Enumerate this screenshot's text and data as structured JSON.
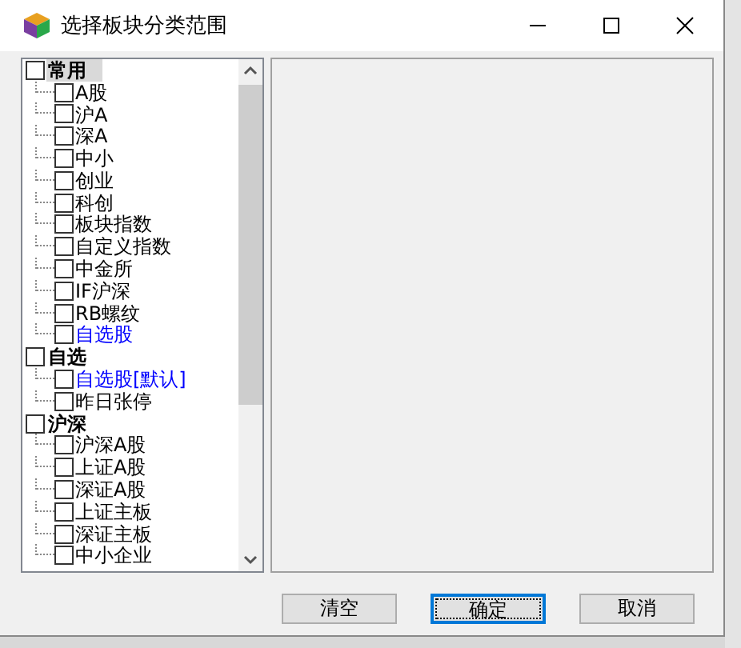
{
  "window": {
    "title": "选择板块分类范围"
  },
  "tree": [
    {
      "label": "常用",
      "checked": false,
      "selected": true,
      "children": [
        {
          "label": "A股",
          "checked": false,
          "color": "#000000"
        },
        {
          "label": "沪A",
          "checked": false,
          "color": "#000000"
        },
        {
          "label": "深A",
          "checked": false,
          "color": "#000000"
        },
        {
          "label": "中小",
          "checked": false,
          "color": "#000000"
        },
        {
          "label": "创业",
          "checked": false,
          "color": "#000000"
        },
        {
          "label": "科创",
          "checked": false,
          "color": "#000000"
        },
        {
          "label": "板块指数",
          "checked": false,
          "color": "#000000"
        },
        {
          "label": "自定义指数",
          "checked": false,
          "color": "#000000"
        },
        {
          "label": "中金所",
          "checked": false,
          "color": "#000000"
        },
        {
          "label": "IF沪深",
          "checked": false,
          "color": "#000000"
        },
        {
          "label": "RB螺纹",
          "checked": false,
          "color": "#000000"
        },
        {
          "label": "自选股",
          "checked": false,
          "color": "#0000ff"
        }
      ]
    },
    {
      "label": "自选",
      "checked": false,
      "selected": false,
      "children": [
        {
          "label": "自选股[默认]",
          "checked": false,
          "color": "#0000ff"
        },
        {
          "label": "昨日张停",
          "checked": false,
          "color": "#000000"
        }
      ]
    },
    {
      "label": "沪深",
      "checked": false,
      "selected": false,
      "children": [
        {
          "label": "沪深A股",
          "checked": false,
          "color": "#000000"
        },
        {
          "label": "上证A股",
          "checked": false,
          "color": "#000000"
        },
        {
          "label": "深证A股",
          "checked": false,
          "color": "#000000"
        },
        {
          "label": "上证主板",
          "checked": false,
          "color": "#000000"
        },
        {
          "label": "深证主板",
          "checked": false,
          "color": "#000000"
        },
        {
          "label": "中小企业",
          "checked": false,
          "color": "#000000"
        }
      ]
    }
  ],
  "buttons": [
    {
      "label": "清空",
      "focused": false
    },
    {
      "label": "确定",
      "focused": true
    },
    {
      "label": "取消",
      "focused": false
    }
  ]
}
